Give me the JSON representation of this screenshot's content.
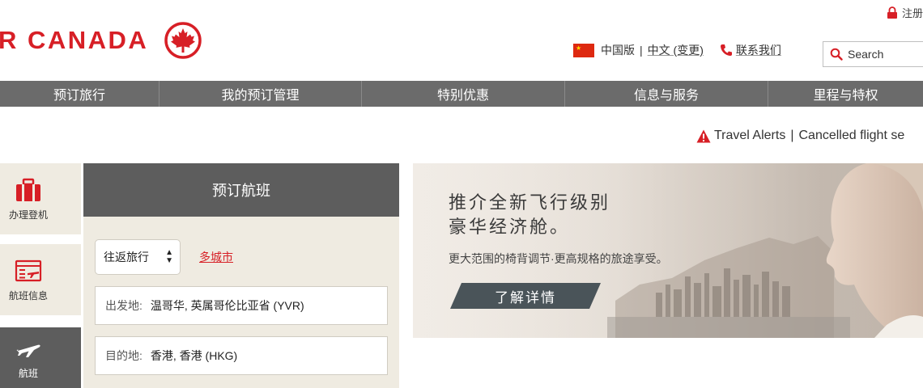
{
  "header": {
    "logo_text": "R CANADA",
    "register_label": "注册",
    "region_label": "中国版",
    "language_label": "中文 (变更)",
    "contact_label": "联系我们",
    "search_placeholder": "Search"
  },
  "nav": {
    "items": [
      "预订旅行",
      "我的预订管理",
      "特别优惠",
      "信息与服务",
      "里程与特权"
    ]
  },
  "alerts": {
    "travel_alerts": "Travel Alerts",
    "separator": "|",
    "cancelled": "Cancelled flight se"
  },
  "rail": {
    "items": [
      {
        "label": "办理登机",
        "icon": "briefcase-icon"
      },
      {
        "label": "航班信息",
        "icon": "flight-board-icon"
      },
      {
        "label": "航班",
        "icon": "plane-icon"
      }
    ]
  },
  "booking": {
    "title": "预订航班",
    "trip_type": "往返旅行",
    "multicity": "多城市",
    "origin_label": "出发地:",
    "origin_value": "温哥华, 英属哥伦比亚省 (YVR)",
    "destination_label": "目的地:",
    "destination_value": "香港, 香港 (HKG)"
  },
  "promo": {
    "title_line1": "推介全新飞行级别",
    "title_line2": "豪华经济舱。",
    "subtitle": "更大范围的椅背调节·更高规格的旅途享受。",
    "button": "了解详情"
  },
  "colors": {
    "brand_red": "#d71f26",
    "nav_gray": "#6b6b6b",
    "panel_beige": "#efebe1",
    "panel_dark": "#5d5d5d"
  }
}
